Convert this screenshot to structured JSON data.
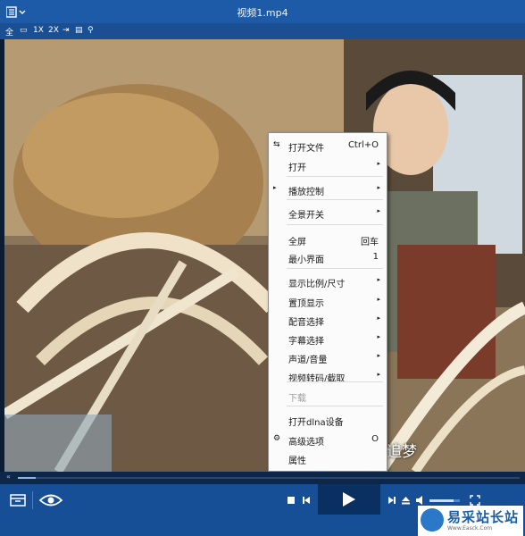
{
  "window": {
    "title": "视频1.mp4"
  },
  "toolbar": {
    "items": [
      "全",
      "▭",
      "1X",
      "2X",
      "⇥",
      "▤",
      "⚲"
    ]
  },
  "subtitle": "追梦",
  "context_menu": {
    "items": [
      {
        "label": "打开文件",
        "shortcut": "Ctrl+O"
      },
      {
        "label": "打开",
        "submenu": "▸"
      },
      {
        "label": "播放控制",
        "submenu": "▸"
      },
      {
        "label": "全景开关",
        "submenu": "▸"
      },
      {
        "label": "全屏",
        "shortcut": "回车"
      },
      {
        "label": "最小界面",
        "shortcut": "1"
      },
      {
        "label": "显示比例/尺寸",
        "submenu": "▸"
      },
      {
        "label": "置顶显示",
        "submenu": "▸"
      },
      {
        "label": "配音选择",
        "submenu": "▸"
      },
      {
        "label": "字幕选择",
        "submenu": "▸"
      },
      {
        "label": "声道/音量",
        "submenu": "▸"
      },
      {
        "label": "视频转码/截取",
        "submenu": "▸"
      },
      {
        "label": "下载"
      },
      {
        "label": "打开dlna设备"
      },
      {
        "label": "高级选项",
        "shortcut": "O"
      },
      {
        "label": "属性"
      }
    ]
  },
  "playback": {
    "progress": 0.035,
    "volume": 0.8
  },
  "watermark": {
    "brand": "易采站长站",
    "url": "Www.Easck.Com"
  },
  "colors": {
    "titlebar": "#1d5ba8",
    "controlbar": "#174f97",
    "accent": "#4a86d2"
  }
}
